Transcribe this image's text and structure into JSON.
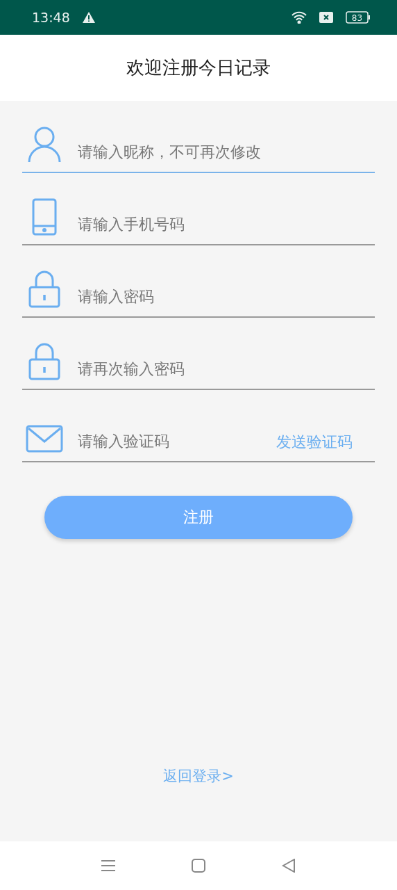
{
  "status_bar": {
    "time": "13:48",
    "battery": "83"
  },
  "header": {
    "title": "欢迎注册今日记录"
  },
  "fields": [
    {
      "kind": "user",
      "placeholder": "请输入昵称，不可再次修改",
      "focused": true
    },
    {
      "kind": "phone",
      "placeholder": "请输入手机号码",
      "focused": false
    },
    {
      "kind": "lock",
      "placeholder": "请输入密码",
      "focused": false
    },
    {
      "kind": "lock",
      "placeholder": "请再次输入密码",
      "focused": false
    },
    {
      "kind": "mail",
      "placeholder": "请输入验证码",
      "focused": false,
      "action": "发送验证码"
    }
  ],
  "submit_button": "注册",
  "back_link": "返回登录>"
}
